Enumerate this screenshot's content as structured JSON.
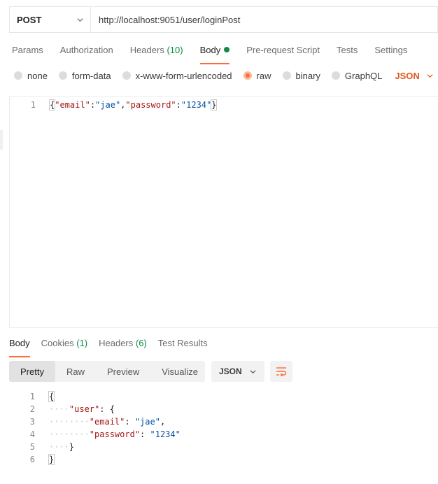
{
  "request": {
    "method": "POST",
    "url": "http://localhost:9051/user/loginPost"
  },
  "req_tabs": [
    {
      "label": "Params"
    },
    {
      "label": "Authorization"
    },
    {
      "label": "Headers",
      "count": "(10)"
    },
    {
      "label": "Body"
    },
    {
      "label": "Pre-request Script"
    },
    {
      "label": "Tests"
    },
    {
      "label": "Settings"
    }
  ],
  "body_options": [
    {
      "label": "none"
    },
    {
      "label": "form-data"
    },
    {
      "label": "x-www-form-urlencoded"
    },
    {
      "label": "raw"
    },
    {
      "label": "binary"
    },
    {
      "label": "GraphQL"
    }
  ],
  "body_language": "JSON",
  "request_body": {
    "line_number": "1",
    "open_brace": "{",
    "text_1": "\"email\"",
    "colon_1": ":",
    "text_2": "\"jae\"",
    "comma": ",",
    "text_3": "\"password\"",
    "colon_2": ":",
    "text_4": "\"1234\"",
    "close_brace": "}"
  },
  "resp_tabs": [
    {
      "label": "Body"
    },
    {
      "label": "Cookies",
      "count": "(1)"
    },
    {
      "label": "Headers",
      "count": "(6)"
    },
    {
      "label": "Test Results"
    }
  ],
  "view_modes": [
    "Pretty",
    "Raw",
    "Preview",
    "Visualize"
  ],
  "response_format": "JSON",
  "response_lines": [
    {
      "n": "1",
      "indent": "",
      "parts": [
        {
          "t": "{",
          "c": "p"
        }
      ]
    },
    {
      "n": "2",
      "indent": "····",
      "parts": [
        {
          "t": "\"user\"",
          "c": "key"
        },
        {
          "t": ": {",
          "c": "p"
        }
      ]
    },
    {
      "n": "3",
      "indent": "········",
      "parts": [
        {
          "t": "\"email\"",
          "c": "key"
        },
        {
          "t": ": ",
          "c": "p"
        },
        {
          "t": "\"jae\"",
          "c": "val"
        },
        {
          "t": ",",
          "c": "p"
        }
      ]
    },
    {
      "n": "4",
      "indent": "········",
      "parts": [
        {
          "t": "\"password\"",
          "c": "key"
        },
        {
          "t": ": ",
          "c": "p"
        },
        {
          "t": "\"1234\"",
          "c": "val"
        }
      ]
    },
    {
      "n": "5",
      "indent": "····",
      "parts": [
        {
          "t": "}",
          "c": "p"
        }
      ]
    },
    {
      "n": "6",
      "indent": "",
      "parts": [
        {
          "t": "}",
          "c": "p"
        }
      ]
    }
  ],
  "colors": {
    "accent": "#ff6c37",
    "count_green": "#0f8a4a",
    "json_orange": "#e0561d",
    "key_red": "#a31515",
    "value_blue": "#0451a5"
  }
}
